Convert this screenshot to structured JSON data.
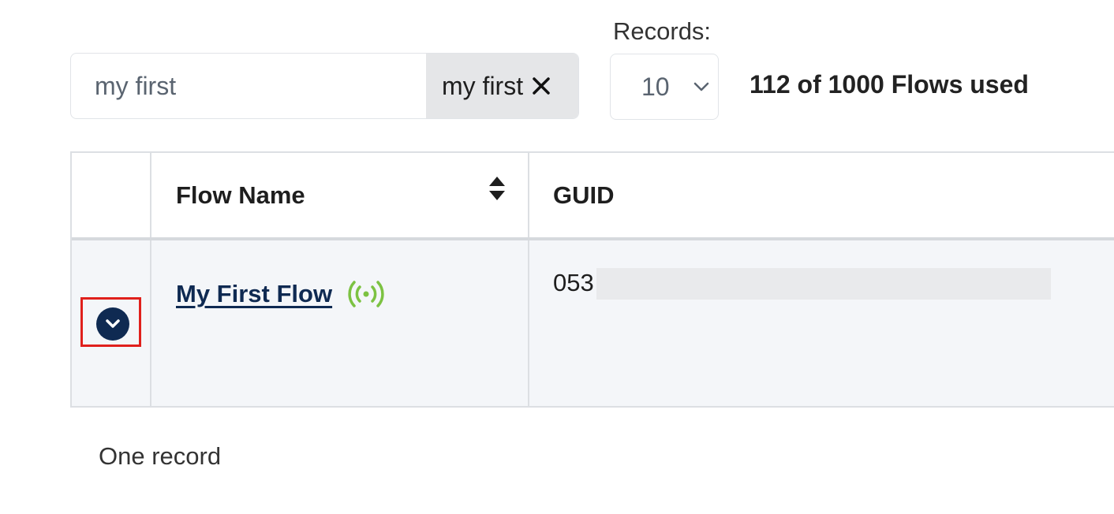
{
  "search": {
    "value": "my first",
    "tag_label": "my first",
    "clear_icon": "close-icon"
  },
  "records": {
    "label": "Records:",
    "selected": "10",
    "chevron_icon": "chevron-down-icon"
  },
  "usage_text": "112 of 1000 Flows used",
  "table": {
    "columns": [
      {
        "label": "Flow Name",
        "sortable": true,
        "sort_icon": "sort-icon"
      },
      {
        "label": "GUID",
        "sortable": false
      }
    ],
    "rows": [
      {
        "expand_icon": "chevron-down-circle-icon",
        "name": "My First Flow",
        "status_icon": "broadcast-live-icon",
        "status_color": "#7cc242",
        "guid": "053"
      }
    ]
  },
  "record_count": "One record",
  "colors": {
    "primary": "#0f2a52",
    "live": "#7cc242",
    "highlight": "#e0201c"
  }
}
